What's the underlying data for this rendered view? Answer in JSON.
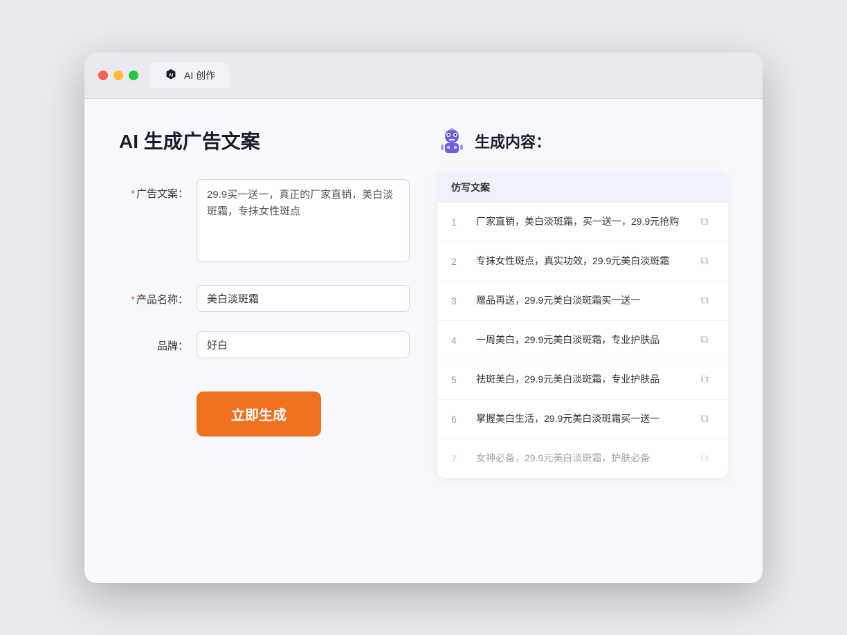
{
  "browser": {
    "tab_label": "AI 创作"
  },
  "page": {
    "title": "AI 生成广告文案",
    "result_title": "生成内容："
  },
  "form": {
    "ad_copy_label": "广告文案：",
    "ad_copy_required": "*",
    "ad_copy_value": "29.9买一送一，真正的厂家直销，美白淡斑霜，专抹女性斑点",
    "product_name_label": "产品名称：",
    "product_name_required": "*",
    "product_name_value": "美白淡斑霜",
    "brand_label": "品牌：",
    "brand_value": "好白",
    "generate_button": "立即生成"
  },
  "results": {
    "table_header": "仿写文案",
    "items": [
      {
        "num": "1",
        "text": "厂家直销，美白淡斑霜，买一送一，29.9元抢购",
        "faded": false
      },
      {
        "num": "2",
        "text": "专抹女性斑点，真实功效，29.9元美白淡斑霜",
        "faded": false
      },
      {
        "num": "3",
        "text": "赠品再送，29.9元美白淡斑霜买一送一",
        "faded": false
      },
      {
        "num": "4",
        "text": "一周美白，29.9元美白淡斑霜，专业护肤品",
        "faded": false
      },
      {
        "num": "5",
        "text": "祛斑美白，29.9元美白淡斑霜，专业护肤品",
        "faded": false
      },
      {
        "num": "6",
        "text": "掌握美白生活，29.9元美白淡斑霜买一送一",
        "faded": false
      },
      {
        "num": "7",
        "text": "女神必备，29.9元美白淡斑霜，护肤必备",
        "faded": true
      }
    ]
  }
}
